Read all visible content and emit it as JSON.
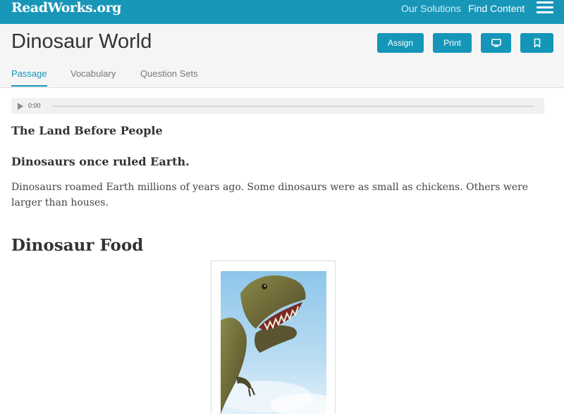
{
  "header": {
    "logo": "ReadWorks.org",
    "nav_solutions": "Our Solutions",
    "nav_find_content": "Find Content"
  },
  "page": {
    "title": "Dinosaur World",
    "assign_label": "Assign",
    "print_label": "Print"
  },
  "tabs": [
    {
      "label": "Passage",
      "active": true
    },
    {
      "label": "Vocabulary",
      "active": false
    },
    {
      "label": "Question Sets",
      "active": false
    }
  ],
  "audio": {
    "time": "0:00",
    "progress": 0
  },
  "passage": {
    "section_title": "The Land Before People",
    "subheading": "Dinosaurs once ruled Earth.",
    "paragraph": "Dinosaurs roamed Earth millions of years ago. Some dinosaurs were as small as chickens. Others were larger than houses.",
    "food_heading": "Dinosaur Food"
  },
  "icons": {
    "menu": "hamburger-menu-icon",
    "present": "monitor-icon",
    "bookmark": "bookmark-icon",
    "play": "play-icon"
  },
  "colors": {
    "brand": "#1896b8",
    "button": "#1596b8",
    "header_bg": "#f5f5f5"
  }
}
